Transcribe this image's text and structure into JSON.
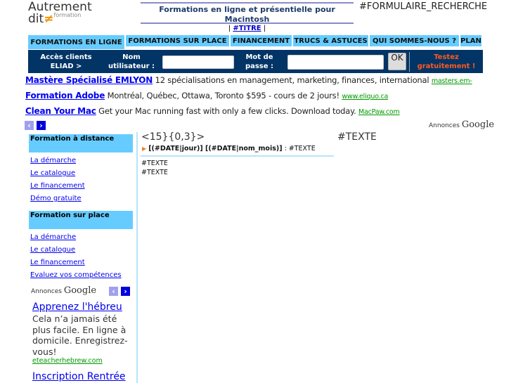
{
  "logo": {
    "line1": "Autrement",
    "line2": "dit",
    "symbol": "≠",
    "sub": "formation"
  },
  "header": {
    "title": "Formations en ligne et présentielle pour Macintosh",
    "titre_link": "#TITRE",
    "formulaire": "#FORMULAIRE_RECHERCHE"
  },
  "nav": [
    "FORMATIONS EN LIGNE",
    "FORMATIONS SUR PLACE",
    "FINANCEMENT",
    "TRUCS & ASTUCES",
    "QUI SOMMES-NOUS ?",
    "PLAN"
  ],
  "login": {
    "clients": "Accès clients ELIAD >",
    "user_label": "Nom utilisateur :",
    "pass_label": "Mot de passe :",
    "ok": "OK",
    "trial": "Testez gratuitement !",
    "trial_color": "#ff5a1f"
  },
  "ads": [
    {
      "title": "Mastère Spécialisé EMLYON",
      "text": "12 spécialisations en management, marketing, finances, international",
      "url": "masters.em-"
    },
    {
      "title": "Formation Adobe",
      "text": "Montréal, Québec, Ottawa, Toronto $595 - cours de 2 jours!",
      "url": "www.eliquo.ca"
    },
    {
      "title": "Clean Your Mac",
      "text": "Get your Mac running fast with only a few clicks. Download today.",
      "url": "MacPaw.com"
    }
  ],
  "annonces": {
    "label": "Annonces",
    "brand": "Google"
  },
  "sidebar": {
    "sec1": {
      "title": "Formation à distance",
      "links": [
        "La démarche",
        "Le catalogue",
        "Le financement",
        "Démo gratuite"
      ]
    },
    "sec2": {
      "title": "Formation sur place",
      "links": [
        "La démarche",
        "Le catalogue",
        "Le financement",
        "Evaluez vos compétences"
      ]
    },
    "ad1": {
      "title": "Apprenez l'hébreu",
      "text": "Cela n’a jamais été plus facile. En ligne à domicile. Enregistrez-vous!",
      "url": "eteacherhebrew.com"
    },
    "ad2": {
      "title": "Inscription Rentrée"
    }
  },
  "main": {
    "heading": "<15}{0,3}>",
    "texte_right": "#TEXTE",
    "date_line": "[(#DATE|jour)] [(#DATE|nom_mois)]",
    "date_suffix": " : #TEXTE",
    "texte1": "#TEXTE",
    "texte2": "#TEXTE"
  }
}
